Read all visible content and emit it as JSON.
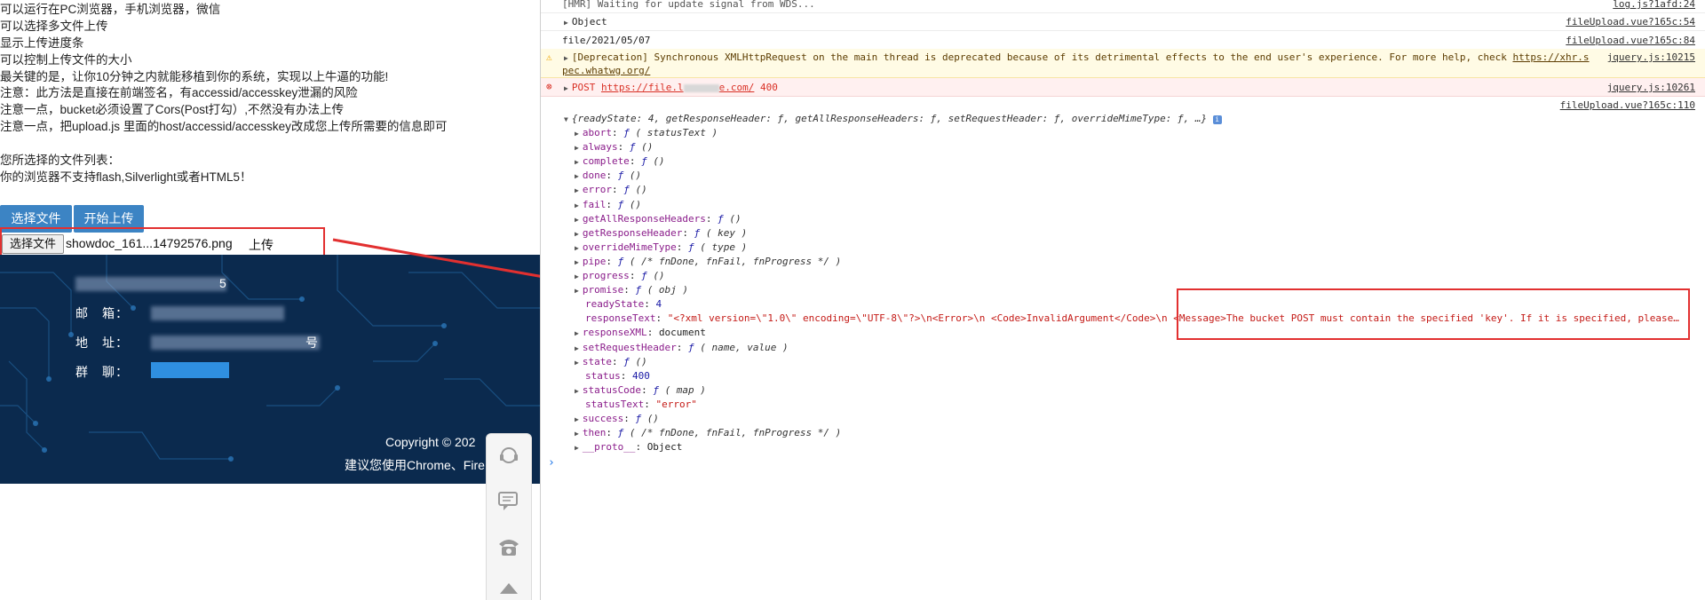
{
  "page": {
    "notes": [
      "可以运行在PC浏览器，手机浏览器，微信",
      "可以选择多文件上传",
      "显示上传进度条",
      "可以控制上传文件的大小",
      "最关键的是，让你10分钟之内就能移植到你的系统，实现以上牛逼的功能!",
      "注意：此方法是直接在前端签名，有accessid/accesskey泄漏的风险",
      "注意一点，bucket必须设置了Cors(Post打勾）,不然没有办法上传",
      "注意一点，把upload.js 里面的host/accessid/accesskey改成您上传所需要的信息即可",
      "",
      "您所选择的文件列表：",
      "你的浏览器不支持flash,Silverlight或者HTML5！"
    ],
    "select_button": "选择文件",
    "start_button": "开始上传",
    "file_input_button": "选择文件",
    "file_name": "showdoc_161...14792576.png",
    "file_upload_link": "上传",
    "footer": {
      "line1_suffix": "5",
      "email_label": "邮　箱：",
      "address_label": "地　址：",
      "address_suffix": "号",
      "group_label": "群　聊：",
      "copyright": "Copyright © 202",
      "browser_note": "建议您使用Chrome、Fire"
    }
  },
  "console": {
    "rows": [
      {
        "text": "[HMR] Waiting for update signal from WDS...",
        "src": "log.js?1afd:24"
      },
      {
        "text": "Object",
        "src": "fileUpload.vue?165c:54"
      },
      {
        "text": "file/2021/05/07",
        "src": "fileUpload.vue?165c:84"
      },
      {
        "text": "[Deprecation] Synchronous XMLHttpRequest on the main thread is deprecated because of its detrimental effects to the end user's experience. For more help, check",
        "link": "https://xhr.s",
        "link2": "pec.whatwg.org/",
        "src": "jquery.js:10215"
      },
      {
        "method": "POST",
        "url": "https://file.l",
        "url_end": "e.com/",
        "status": "400",
        "src": "jquery.js:10261"
      },
      {
        "text": "",
        "src": "fileUpload.vue?165c:110"
      }
    ],
    "object_summary": "{readyState: 4, getResponseHeader: ƒ, getAllResponseHeaders: ƒ, setRequestHeader: ƒ, overrideMimeType: ƒ, …}",
    "props": [
      {
        "key": "abort",
        "sig": "( statusText )",
        "type": "fn"
      },
      {
        "key": "always",
        "sig": "()",
        "type": "fn"
      },
      {
        "key": "complete",
        "sig": "()",
        "type": "fn"
      },
      {
        "key": "done",
        "sig": "()",
        "type": "fn"
      },
      {
        "key": "error",
        "sig": "()",
        "type": "fn"
      },
      {
        "key": "fail",
        "sig": "()",
        "type": "fn"
      },
      {
        "key": "getAllResponseHeaders",
        "sig": "()",
        "type": "fn"
      },
      {
        "key": "getResponseHeader",
        "sig": "( key )",
        "type": "fn"
      },
      {
        "key": "overrideMimeType",
        "sig": "( type )",
        "type": "fn"
      },
      {
        "key": "pipe",
        "sig": "( /* fnDone, fnFail, fnProgress */ )",
        "type": "fn"
      },
      {
        "key": "progress",
        "sig": "()",
        "type": "fn"
      },
      {
        "key": "promise",
        "sig": "( obj )",
        "type": "fn"
      },
      {
        "key": "readyState",
        "value": "4",
        "type": "num"
      },
      {
        "key": "responseText",
        "value": "\"<?xml version=\\\"1.0\\\" encoding=\\\"UTF-8\\\"?>\\n<Error>\\n  <Code>InvalidArgument</Code>\\n  <Message>The bucket POST must contain the specified 'key'. If it is specified, please…",
        "type": "str"
      },
      {
        "key": "responseXML",
        "value": "document",
        "type": "obj"
      },
      {
        "key": "setRequestHeader",
        "sig": "( name, value )",
        "type": "fn"
      },
      {
        "key": "state",
        "sig": "()",
        "type": "fn"
      },
      {
        "key": "status",
        "value": "400",
        "type": "num"
      },
      {
        "key": "statusCode",
        "sig": "( map )",
        "type": "fn"
      },
      {
        "key": "statusText",
        "value": "\"error\"",
        "type": "str"
      },
      {
        "key": "success",
        "sig": "()",
        "type": "fn"
      },
      {
        "key": "then",
        "sig": "( /* fnDone, fnFail, fnProgress */ )",
        "type": "fn"
      },
      {
        "key": "__proto__",
        "value": "Object",
        "type": "obj"
      }
    ],
    "prompt": "›"
  },
  "colors": {
    "button_blue": "#3c84c4",
    "highlight_red": "#e23030",
    "footer_navy": "#0b2a4e"
  }
}
